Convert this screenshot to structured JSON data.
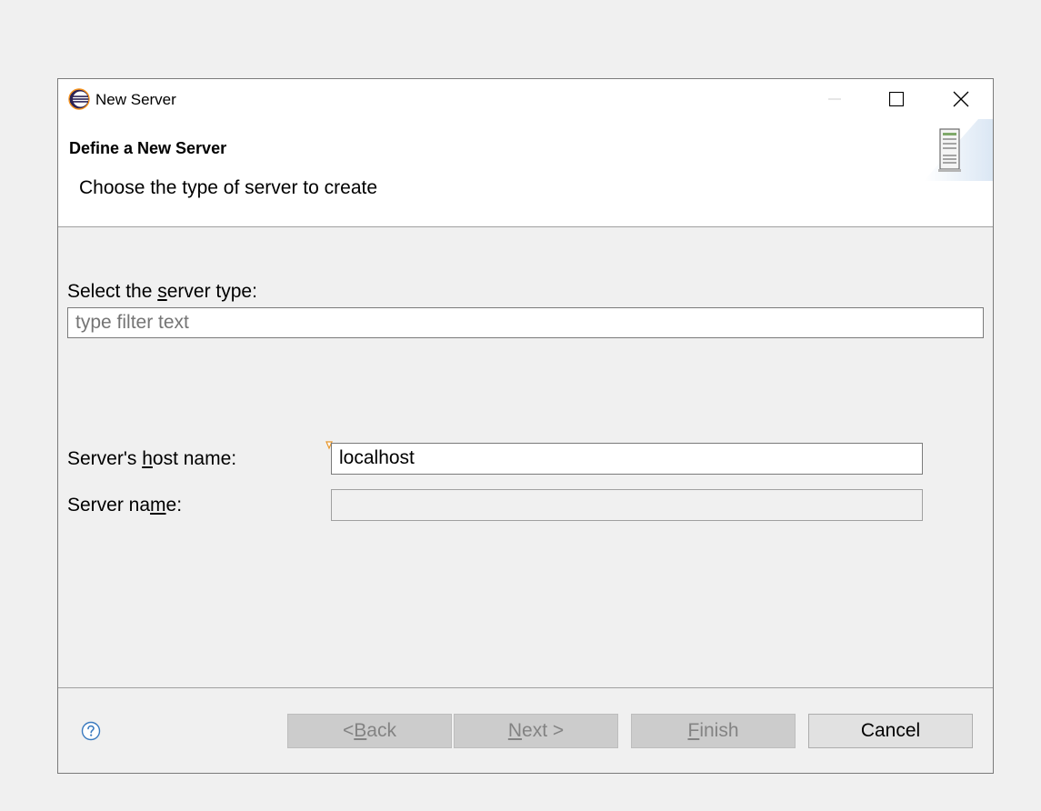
{
  "window": {
    "title": "New Server",
    "controls": {
      "minimize_icon": "minimize-icon",
      "maximize_icon": "maximize-icon",
      "close_icon": "close-icon"
    }
  },
  "header": {
    "title": "Define a New Server",
    "description": "Choose the type of server to create",
    "banner_icon": "server-icon"
  },
  "form": {
    "server_type_label_pre": "Select the ",
    "server_type_label_mnemonic": "s",
    "server_type_label_post": "erver type:",
    "server_type_filter": {
      "value": "",
      "placeholder": "type filter text"
    },
    "host_label_pre": "Server's ",
    "host_label_mnemonic": "h",
    "host_label_post": "ost name:",
    "host_value": "localhost",
    "name_label_pre": "Server na",
    "name_label_mnemonic": "m",
    "name_label_post": "e:",
    "name_value": ""
  },
  "footer": {
    "help_icon": "help-icon",
    "back_pre": "< ",
    "back_mnemonic": "B",
    "back_post": "ack",
    "next_mnemonic": "N",
    "next_post": "ext >",
    "finish_mnemonic": "F",
    "finish_post": "inish",
    "cancel": "Cancel"
  },
  "colors": {
    "background": "#f0f0f0",
    "header_background": "#ffffff",
    "disabled_text": "#838383",
    "accent": "#3a7abf"
  }
}
